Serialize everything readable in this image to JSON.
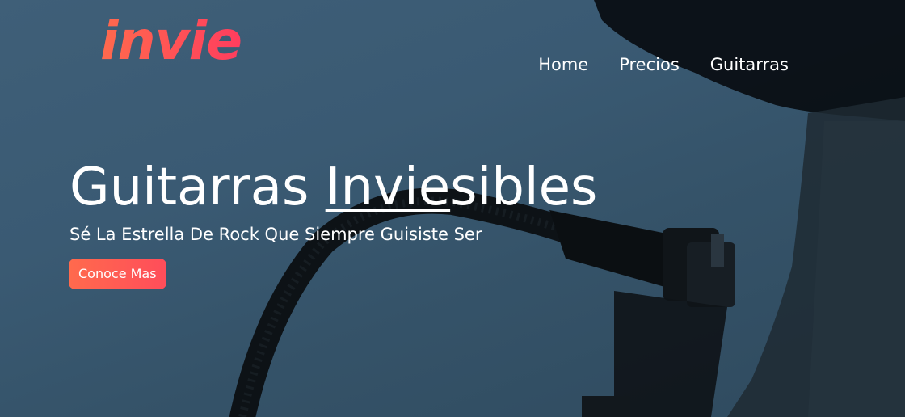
{
  "brand": {
    "logo_text": "invie",
    "accent_start": "#ff6a4d",
    "accent_end": "#ff3d5e"
  },
  "nav": {
    "items": [
      {
        "label": "Home"
      },
      {
        "label": "Precios"
      },
      {
        "label": "Guitarras"
      }
    ]
  },
  "hero": {
    "headline_before": "Guitarras ",
    "headline_underlined": "Invie",
    "headline_after": "sibles",
    "subheadline": "Sé La Estrella De Rock Que Siempre Guisiste Ser",
    "cta_label": "Conoce Mas",
    "background_color": "#3a5a73"
  }
}
